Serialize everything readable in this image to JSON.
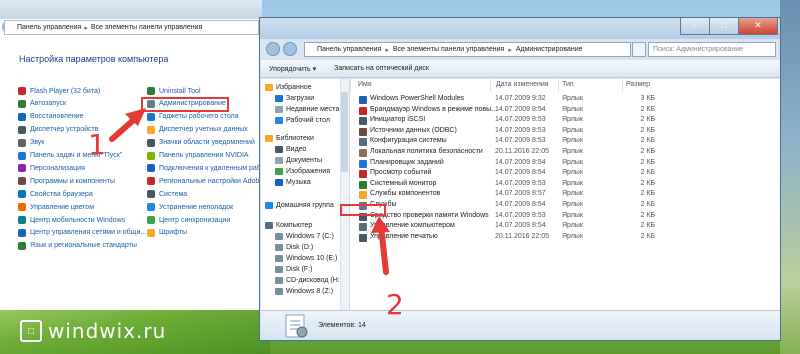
{
  "control_panel": {
    "breadcrumb": [
      "Панель управления",
      "Все элементы панели управления"
    ],
    "heading": "Настройка параметров компьютера",
    "left_items": [
      {
        "label": "Flash Player (32 бита)",
        "color": "#c62828"
      },
      {
        "label": "Автозапуск",
        "color": "#2e7d32"
      },
      {
        "label": "Восстановление",
        "color": "#1565c0"
      },
      {
        "label": "Диспетчер устройств",
        "color": "#455a64"
      },
      {
        "label": "Звук",
        "color": "#616161"
      },
      {
        "label": "Панель задач и меню \"Пуск\"",
        "color": "#1976d2"
      },
      {
        "label": "Персонализация",
        "color": "#8e24aa"
      },
      {
        "label": "Программы и компоненты",
        "color": "#6d4c41"
      },
      {
        "label": "Свойства браузера",
        "color": "#0277bd"
      },
      {
        "label": "Управление цветом",
        "color": "#ef6c00"
      },
      {
        "label": "Центр мобильности Windows",
        "color": "#00838f"
      },
      {
        "label": "Центр управления сетями и общи...",
        "color": "#1565c0"
      },
      {
        "label": "Язык и региональные стандарты",
        "color": "#2e7d32"
      }
    ],
    "right_items": [
      {
        "label": "Uninstall Tool",
        "color": "#2e7d32"
      },
      {
        "label": "Администрирование",
        "color": "#607d8b"
      },
      {
        "label": "Гаджеты рабочего стола",
        "color": "#1976d2"
      },
      {
        "label": "Диспетчер учетных данных",
        "color": "#f9a825"
      },
      {
        "label": "Значки области уведомлений",
        "color": "#455a64"
      },
      {
        "label": "Панель управления NVIDIA",
        "color": "#76b900"
      },
      {
        "label": "Подключения к удаленным рабочим ...",
        "color": "#1565c0"
      },
      {
        "label": "Региональные настройки Adobe Flash Player",
        "color": "#c62828"
      },
      {
        "label": "Система",
        "color": "#455a64"
      },
      {
        "label": "Устранение неполадок",
        "color": "#1e88e5"
      },
      {
        "label": "Центр синхронизации",
        "color": "#43a047"
      },
      {
        "label": "Шрифты",
        "color": "#f9a825"
      }
    ]
  },
  "admin_window": {
    "breadcrumb": [
      "Панель управления",
      "Все элементы панели управления",
      "Администрирование"
    ],
    "search_placeholder": "Поиск: Администрирование",
    "toolbar": {
      "organize": "Упорядочить ▾",
      "burn": "Записать на оптический диск"
    },
    "nav": [
      {
        "label": "Избранное",
        "color": "#f9a825",
        "indent": 0
      },
      {
        "label": "Загрузки",
        "color": "#1976d2",
        "indent": 1
      },
      {
        "label": "Недавние места",
        "color": "#90a4ae",
        "indent": 1
      },
      {
        "label": "Рабочий стол",
        "color": "#1e88e5",
        "indent": 1
      },
      {
        "label": "Библиотеки",
        "color": "#f9a825",
        "indent": 0
      },
      {
        "label": "Видео",
        "color": "#455a64",
        "indent": 1
      },
      {
        "label": "Документы",
        "color": "#90a4ae",
        "indent": 1
      },
      {
        "label": "Изображения",
        "color": "#43a047",
        "indent": 1
      },
      {
        "label": "Музыка",
        "color": "#1565c0",
        "indent": 1
      },
      {
        "label": "Домашняя группа",
        "color": "#1e88e5",
        "indent": 0
      },
      {
        "label": "Компьютер",
        "color": "#546e7a",
        "indent": 0
      },
      {
        "label": "Windows 7 (C:)",
        "color": "#78909c",
        "indent": 1
      },
      {
        "label": "Disk (D:)",
        "color": "#78909c",
        "indent": 1
      },
      {
        "label": "Windows 10 (E:)",
        "color": "#78909c",
        "indent": 1
      },
      {
        "label": "Disk (F:)",
        "color": "#78909c",
        "indent": 1
      },
      {
        "label": "CD-дисковод (H:)",
        "color": "#78909c",
        "indent": 1
      },
      {
        "label": "Windows 8 (Z:)",
        "color": "#78909c",
        "indent": 1
      }
    ],
    "columns": [
      "Имя",
      "Дата изменения",
      "Тип",
      "Размер"
    ],
    "files": [
      {
        "name": "Windows PowerShell Modules",
        "date": "14.07.2009 9:32",
        "type": "Ярлык",
        "size": "3 КБ",
        "color": "#1e63b5"
      },
      {
        "name": "Брандмауэр Windows в режиме повы...",
        "date": "14.07.2009 8:54",
        "type": "Ярлык",
        "size": "2 КБ",
        "color": "#c62828"
      },
      {
        "name": "Инициатор iSCSI",
        "date": "14.07.2009 8:53",
        "type": "Ярлык",
        "size": "2 КБ",
        "color": "#455a64"
      },
      {
        "name": "Источники данных (ODBC)",
        "date": "14.07.2009 8:53",
        "type": "Ярлык",
        "size": "2 КБ",
        "color": "#6d4c41"
      },
      {
        "name": "Конфигурация системы",
        "date": "14.07.2009 8:53",
        "type": "Ярлык",
        "size": "2 КБ",
        "color": "#546e7a"
      },
      {
        "name": "Локальная политика безопасности",
        "date": "20.11.2016 22:05",
        "type": "Ярлык",
        "size": "2 КБ",
        "color": "#8d6e63"
      },
      {
        "name": "Планировщик заданий",
        "date": "14.07.2009 8:54",
        "type": "Ярлык",
        "size": "2 КБ",
        "color": "#1976d2"
      },
      {
        "name": "Просмотр событий",
        "date": "14.07.2009 8:54",
        "type": "Ярлык",
        "size": "2 КБ",
        "color": "#c62828"
      },
      {
        "name": "Системный монитор",
        "date": "14.07.2009 8:53",
        "type": "Ярлык",
        "size": "2 КБ",
        "color": "#2e7d32"
      },
      {
        "name": "Службы компонентов",
        "date": "14.07.2009 8:57",
        "type": "Ярлык",
        "size": "2 КБ",
        "color": "#f9a825"
      },
      {
        "name": "Службы",
        "date": "14.07.2009 8:54",
        "type": "Ярлык",
        "size": "2 КБ",
        "color": "#607d8b"
      },
      {
        "name": "Средство проверки памяти Windows",
        "date": "14.07.2009 8:53",
        "type": "Ярлык",
        "size": "2 КБ",
        "color": "#455a64"
      },
      {
        "name": "Управление компьютером",
        "date": "14.07.2009 8:54",
        "type": "Ярлык",
        "size": "2 КБ",
        "color": "#546e7a"
      },
      {
        "name": "Управление печатью",
        "date": "20.11.2016 22:05",
        "type": "Ярлык",
        "size": "2 КБ",
        "color": "#455a64"
      }
    ],
    "details_count": "Элементов: 14"
  },
  "annotations": {
    "step1": "1",
    "step2": "2",
    "arrow_color": "#e53935"
  },
  "watermark": {
    "mark": "□",
    "text": "windwix.ru"
  }
}
